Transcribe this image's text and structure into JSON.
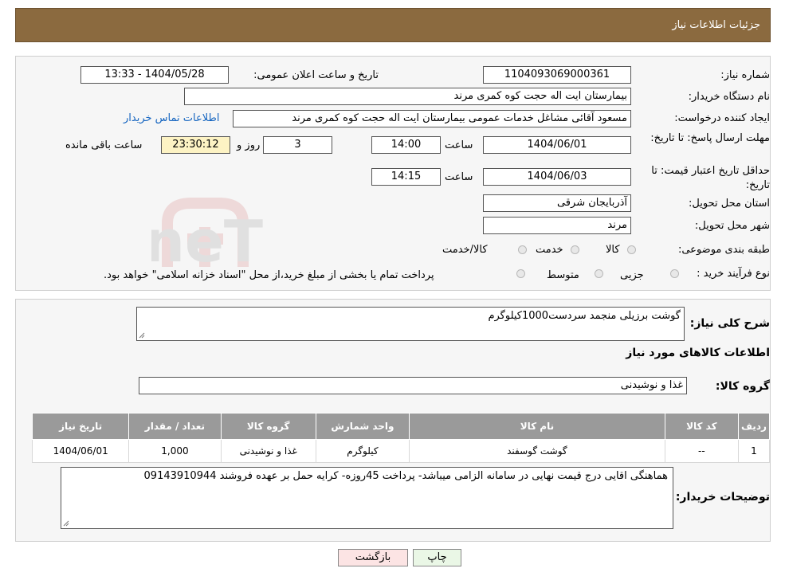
{
  "header": {
    "title": "جزئیات اطلاعات نیاز"
  },
  "form": {
    "need_number_label": "شماره نیاز:",
    "need_number": "1104093069000361",
    "announce_label": "تاریخ و ساعت اعلان عمومی:",
    "announce_value": "1404/05/28 - 13:33",
    "buyer_org_label": "نام دستگاه خریدار:",
    "buyer_org": "بیمارستان ایت اله حجت کوه کمری مرند",
    "requester_label": "ایجاد کننده درخواست:",
    "requester": "مسعود آقائی مشاغل خدمات عمومی بیمارستان ایت اله حجت کوه کمری مرند",
    "contact_link": "اطلاعات تماس خریدار",
    "deadline_label": "مهلت ارسال پاسخ: تا تاریخ:",
    "deadline_date": "1404/06/01",
    "time_label": "ساعت",
    "deadline_time": "14:00",
    "days_value": "3",
    "days_label": "روز و",
    "remaining_time": "23:30:12",
    "remaining_label": "ساعت باقی مانده",
    "price_validity_label": "حداقل تاریخ اعتبار قیمت: تا تاریخ:",
    "price_validity_date": "1404/06/03",
    "price_validity_time": "14:15",
    "province_label": "استان محل تحویل:",
    "province": "آذربایجان شرقی",
    "city_label": "شهر محل تحویل:",
    "city": "مرند",
    "category_label": "طبقه بندی موضوعی:",
    "category_options": [
      "کالا",
      "خدمت",
      "کالا/خدمت"
    ],
    "process_label": "نوع فرآیند خرید :",
    "process_options": [
      "جزیی",
      "متوسط"
    ],
    "process_note": "پرداخت تمام یا بخشی از مبلغ خرید،از محل \"اسناد خزانه اسلامی\" خواهد بود."
  },
  "details": {
    "description_label": "شرح کلی نیاز:",
    "description": "گوشت برزیلی منجمد سردست1000کیلوگرم",
    "items_title": "اطلاعات کالاهای مورد نیاز",
    "group_label": "گروه کالا:",
    "group_value": "غذا و نوشیدنی"
  },
  "table": {
    "headers": [
      "ردیف",
      "کد کالا",
      "نام کالا",
      "واحد شمارش",
      "گروه کالا",
      "تعداد / مقدار",
      "تاریخ نیاز"
    ],
    "rows": [
      [
        "1",
        "--",
        "گوشت گوسفند",
        "کیلوگرم",
        "غذا و نوشیدنی",
        "1,000",
        "1404/06/01"
      ]
    ]
  },
  "buyer_notes": {
    "label": "توضیحات خریدار:",
    "text": "هماهنگی اقایی درج قیمت نهایی در سامانه الزامی میباشد- پرداخت 45روزه- کرایه حمل بر عهده فروشند 09143910944"
  },
  "buttons": {
    "print": "چاپ",
    "back": "بازگشت"
  },
  "watermark": {
    "text": "AriaTender.neT"
  }
}
